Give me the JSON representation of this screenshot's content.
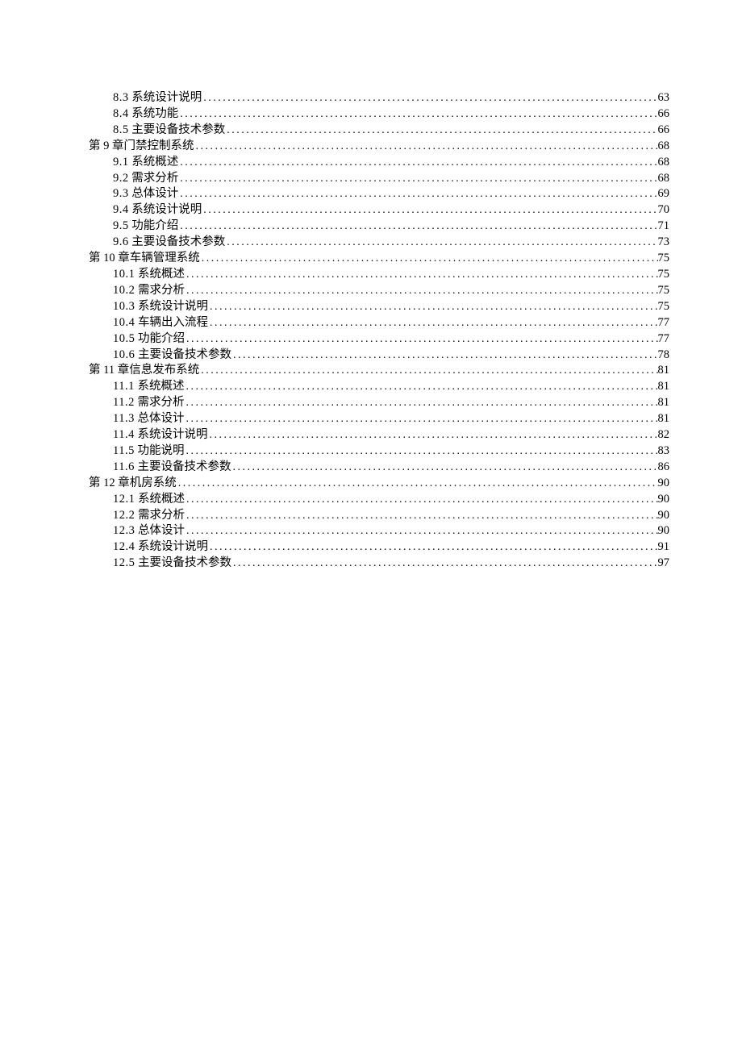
{
  "toc": [
    {
      "level": "sub",
      "num": "8.3",
      "title": "系统设计说明",
      "page": "63"
    },
    {
      "level": "sub",
      "num": "8.4",
      "title": "系统功能",
      "page": "66"
    },
    {
      "level": "sub",
      "num": "8.5",
      "title": "主要设备技术参数",
      "page": "66"
    },
    {
      "level": "chapter",
      "num": "第 9 章",
      "title": "门禁控制系统",
      "page": "68"
    },
    {
      "level": "sub",
      "num": "9.1",
      "title": "系统概述",
      "page": "68"
    },
    {
      "level": "sub",
      "num": "9.2",
      "title": "需求分析",
      "page": "68"
    },
    {
      "level": "sub",
      "num": "9.3",
      "title": "总体设计",
      "page": "69"
    },
    {
      "level": "sub",
      "num": "9.4",
      "title": "系统设计说明",
      "page": "70"
    },
    {
      "level": "sub",
      "num": "9.5",
      "title": "功能介绍",
      "page": "71"
    },
    {
      "level": "sub",
      "num": "9.6",
      "title": "主要设备技术参数",
      "page": "73"
    },
    {
      "level": "chapter",
      "num": "第 10 章",
      "title": "车辆管理系统",
      "page": "75"
    },
    {
      "level": "sub",
      "num": "10.1",
      "title": "系统概述",
      "page": "75"
    },
    {
      "level": "sub",
      "num": "10.2",
      "title": "需求分析",
      "page": "75"
    },
    {
      "level": "sub",
      "num": "10.3",
      "title": "系统设计说明",
      "page": "75"
    },
    {
      "level": "sub",
      "num": "10.4",
      "title": "车辆出入流程",
      "page": "77"
    },
    {
      "level": "sub",
      "num": "10.5",
      "title": "功能介绍",
      "page": "77"
    },
    {
      "level": "sub",
      "num": "10.6",
      "title": "主要设备技术参数",
      "page": "78"
    },
    {
      "level": "chapter",
      "num": "第 11 章",
      "title": "信息发布系统",
      "page": "81"
    },
    {
      "level": "sub",
      "num": "11.1",
      "title": "系统概述",
      "page": "81"
    },
    {
      "level": "sub",
      "num": "11.2",
      "title": "需求分析",
      "page": "81"
    },
    {
      "level": "sub",
      "num": "11.3",
      "title": "总体设计",
      "page": "81"
    },
    {
      "level": "sub",
      "num": "11.4",
      "title": "系统设计说明",
      "page": "82"
    },
    {
      "level": "sub",
      "num": "11.5",
      "title": "功能说明",
      "page": "83"
    },
    {
      "level": "sub",
      "num": "11.6",
      "title": "主要设备技术参数",
      "page": "86"
    },
    {
      "level": "chapter",
      "num": "第 12 章",
      "title": "机房系统",
      "page": "90"
    },
    {
      "level": "sub",
      "num": "12.1",
      "title": "系统概述",
      "page": "90"
    },
    {
      "level": "sub",
      "num": "12.2",
      "title": "需求分析",
      "page": "90"
    },
    {
      "level": "sub",
      "num": "12.3",
      "title": "总体设计",
      "page": "90"
    },
    {
      "level": "sub",
      "num": "12.4",
      "title": "系统设计说明",
      "page": "91"
    },
    {
      "level": "sub",
      "num": "12.5",
      "title": "主要设备技术参数",
      "page": "97"
    }
  ]
}
